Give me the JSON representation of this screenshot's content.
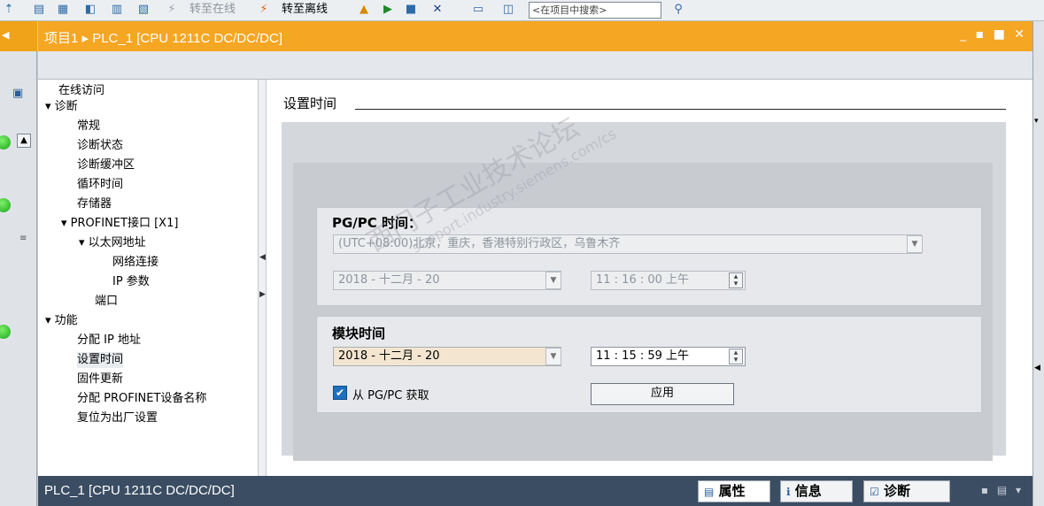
{
  "toolbar": {
    "go_online_label": "转至在线",
    "go_offline_label": "转至离线",
    "search_placeholder": "<在项目中搜索>"
  },
  "editor": {
    "title": "项目1 ▸ PLC_1 [CPU 1211C DC/DC/DC]",
    "window_controls": "_ ▪ ■ ✕"
  },
  "nav": {
    "items": [
      {
        "label": "在线访问"
      },
      {
        "label": "▾ 诊断"
      },
      {
        "label": "常规"
      },
      {
        "label": "诊断状态"
      },
      {
        "label": "诊断缓冲区"
      },
      {
        "label": "循环时间"
      },
      {
        "label": "存储器"
      },
      {
        "label": "▾ PROFINET接口 [X1]"
      },
      {
        "label": "▾ 以太网地址"
      },
      {
        "label": "网络连接"
      },
      {
        "label": "IP 参数"
      },
      {
        "label": "端口"
      },
      {
        "label": "▾ 功能"
      },
      {
        "label": "分配 IP 地址"
      },
      {
        "label": "设置时间"
      },
      {
        "label": "固件更新"
      },
      {
        "label": "分配 PROFINET设备名称"
      },
      {
        "label": "复位为出厂设置"
      }
    ],
    "selected": "设置时间"
  },
  "content": {
    "section_title": "设置时间",
    "pgpc": {
      "title": "PG/PC 时间：",
      "timezone": "(UTC+08:00)北京，重庆，香港特别行政区，乌鲁木齐",
      "date": "2018 - 十二月  - 20",
      "time": "11 : 16 : 00   上午"
    },
    "module": {
      "title": "模块时间",
      "date": "2018 - 十二月  - 20",
      "time": "11 : 15 : 59   上午",
      "checkbox_label": "从 PG/PC 获取",
      "checkbox_checked": true,
      "apply_label": "应用"
    }
  },
  "watermark": {
    "line1": "西门子工业技术论坛",
    "line2": "support.industry.siemens.com/cs"
  },
  "status_bar": {
    "title": "PLC_1 [CPU 1211C DC/DC/DC]",
    "tabs": [
      {
        "label": "属性"
      },
      {
        "label": "信息"
      },
      {
        "label": "诊断"
      }
    ]
  }
}
